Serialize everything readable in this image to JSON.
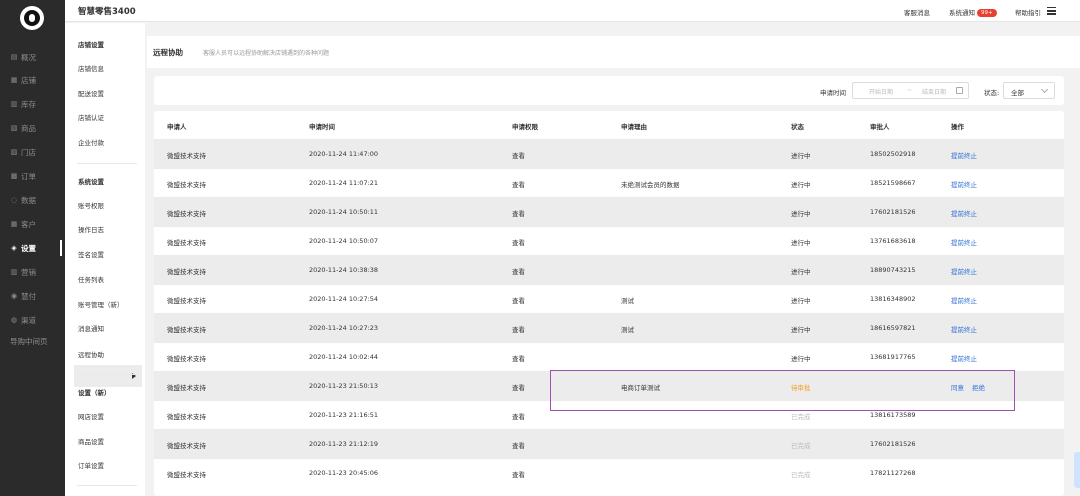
{
  "app": {
    "brand": "智慧零售3400"
  },
  "topbar": {
    "customer_msg": "客服消息",
    "sys_notice": "系统通知",
    "sys_notice_badge": "99+",
    "help": "帮助指引"
  },
  "sidebar": {
    "items": [
      {
        "label": "概况",
        "icon": "chart-icon"
      },
      {
        "label": "店铺",
        "icon": "store-icon"
      },
      {
        "label": "库存",
        "icon": "inventory-icon"
      },
      {
        "label": "商品",
        "icon": "goods-icon"
      },
      {
        "label": "门店",
        "icon": "shop-icon"
      },
      {
        "label": "订单",
        "icon": "order-icon"
      },
      {
        "label": "数据",
        "icon": "data-icon"
      },
      {
        "label": "客户",
        "icon": "customer-icon"
      },
      {
        "label": "设置",
        "icon": "settings-icon"
      },
      {
        "label": "营销",
        "icon": "marketing-icon"
      },
      {
        "label": "慧付",
        "icon": "pay-icon"
      },
      {
        "label": "渠道",
        "icon": "channel-icon"
      },
      {
        "label": "导购中间页",
        "icon": ""
      }
    ]
  },
  "subnav": {
    "groups": [
      {
        "items": [
          "店铺设置",
          "店铺信息",
          "配送设置",
          "店铺认证",
          "企业付款"
        ]
      },
      {
        "items": [
          "系统设置",
          "账号权限",
          "操作日志",
          "签名设置",
          "任务列表",
          "账号管理（新）",
          "消息通知",
          "远程协助"
        ]
      },
      {
        "items": [
          "设置（新）",
          "网店设置",
          "商品设置",
          "订单设置"
        ]
      }
    ]
  },
  "page": {
    "title": "远程协助",
    "subtitle": "客服人员可以远程协助解决店铺遇到的各种问题"
  },
  "filter": {
    "time_label": "申请时间",
    "start_placeholder": "开始日期",
    "separator": "~",
    "end_placeholder": "结束日期",
    "status_label": "状态:",
    "status_value": "全部"
  },
  "table": {
    "headers": [
      "申请人",
      "申请时间",
      "申请权限",
      "申请理由",
      "状态",
      "审批人",
      "操作"
    ],
    "rows": [
      {
        "applicant": "微盟技术支持",
        "time": "2020-11-24 11:47:00",
        "perm": "查看",
        "reason": "",
        "status": "进行中",
        "status_type": "active",
        "approver": "18502502918",
        "actions": [
          "提前终止"
        ]
      },
      {
        "applicant": "微盟技术支持",
        "time": "2020-11-24 11:07:21",
        "perm": "查看",
        "reason": "未绝测试会员的数据",
        "status": "进行中",
        "status_type": "active",
        "approver": "18521598667",
        "actions": [
          "提前终止"
        ]
      },
      {
        "applicant": "微盟技术支持",
        "time": "2020-11-24 10:50:11",
        "perm": "查看",
        "reason": "",
        "status": "进行中",
        "status_type": "active",
        "approver": "17602181526",
        "actions": [
          "提前终止"
        ]
      },
      {
        "applicant": "微盟技术支持",
        "time": "2020-11-24 10:50:07",
        "perm": "查看",
        "reason": "",
        "status": "进行中",
        "status_type": "active",
        "approver": "13761683618",
        "actions": [
          "提前终止"
        ]
      },
      {
        "applicant": "微盟技术支持",
        "time": "2020-11-24 10:38:38",
        "perm": "查看",
        "reason": "",
        "status": "进行中",
        "status_type": "active",
        "approver": "18890743215",
        "actions": [
          "提前终止"
        ]
      },
      {
        "applicant": "微盟技术支持",
        "time": "2020-11-24 10:27:54",
        "perm": "查看",
        "reason": "测试",
        "status": "进行中",
        "status_type": "active",
        "approver": "13816348902",
        "actions": [
          "提前终止"
        ]
      },
      {
        "applicant": "微盟技术支持",
        "time": "2020-11-24 10:27:23",
        "perm": "查看",
        "reason": "测试",
        "status": "进行中",
        "status_type": "active",
        "approver": "18616597821",
        "actions": [
          "提前终止"
        ]
      },
      {
        "applicant": "微盟技术支持",
        "time": "2020-11-24 10:02:44",
        "perm": "查看",
        "reason": "",
        "status": "进行中",
        "status_type": "active",
        "approver": "13681917765",
        "actions": [
          "提前终止"
        ]
      },
      {
        "applicant": "微盟技术支持",
        "time": "2020-11-23 21:50:13",
        "perm": "查看",
        "reason": "电商订单测试",
        "status": "待审批",
        "status_type": "pending",
        "approver": "",
        "actions": [
          "同意",
          "拒绝"
        ]
      },
      {
        "applicant": "微盟技术支持",
        "time": "2020-11-23 21:16:51",
        "perm": "查看",
        "reason": "",
        "status": "已完成",
        "status_type": "done",
        "approver": "13816173589",
        "actions": []
      },
      {
        "applicant": "微盟技术支持",
        "time": "2020-11-23 21:12:19",
        "perm": "查看",
        "reason": "",
        "status": "已完成",
        "status_type": "done",
        "approver": "17602181526",
        "actions": []
      },
      {
        "applicant": "微盟技术支持",
        "time": "2020-11-23 20:45:06",
        "perm": "查看",
        "reason": "",
        "status": "已完成",
        "status_type": "done",
        "approver": "17821127268",
        "actions": []
      }
    ]
  },
  "colors": {
    "link": "#2f6fd6",
    "pending": "#f0a020",
    "done": "#bbbbbb",
    "sidebar_bg": "#2b2b2b",
    "badge": "#e8402f"
  }
}
